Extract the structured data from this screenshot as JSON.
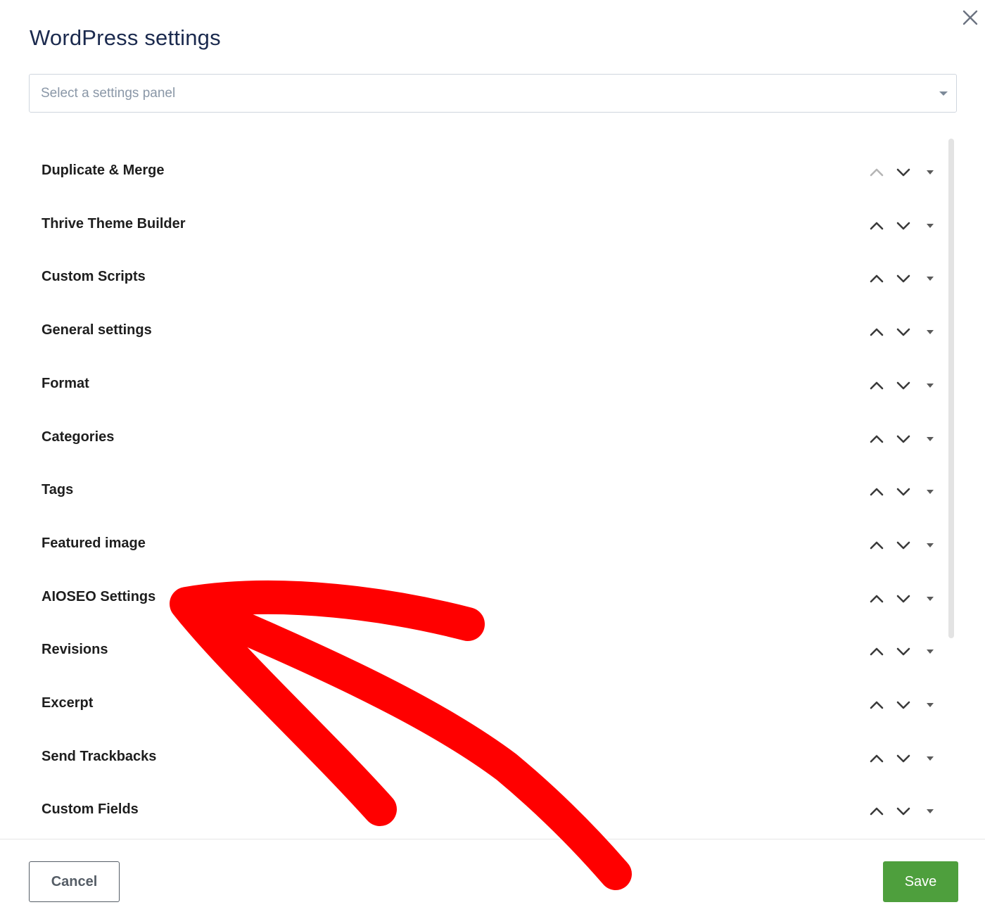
{
  "dialog": {
    "title": "WordPress settings",
    "close_icon": "close-icon"
  },
  "select": {
    "placeholder": "Select a settings panel",
    "arrow_icon": "caret-down-icon"
  },
  "panels": [
    {
      "label": "Duplicate & Merge",
      "move_up_disabled": true
    },
    {
      "label": "Thrive Theme Builder",
      "move_up_disabled": false
    },
    {
      "label": "Custom Scripts",
      "move_up_disabled": false
    },
    {
      "label": "General settings",
      "move_up_disabled": false
    },
    {
      "label": "Format",
      "move_up_disabled": false
    },
    {
      "label": "Categories",
      "move_up_disabled": false
    },
    {
      "label": "Tags",
      "move_up_disabled": false
    },
    {
      "label": "Featured image",
      "move_up_disabled": false
    },
    {
      "label": "AIOSEO Settings",
      "move_up_disabled": false
    },
    {
      "label": "Revisions",
      "move_up_disabled": false
    },
    {
      "label": "Excerpt",
      "move_up_disabled": false
    },
    {
      "label": "Send Trackbacks",
      "move_up_disabled": false
    },
    {
      "label": "Custom Fields",
      "move_up_disabled": false
    }
  ],
  "row_icons": {
    "up": "chevron-up-icon",
    "down": "chevron-down-icon",
    "toggle": "caret-down-icon"
  },
  "footer": {
    "cancel_label": "Cancel",
    "save_label": "Save"
  },
  "colors": {
    "title": "#1b2a4e",
    "save_button": "#4e9f3d",
    "annotation_arrow": "#ff0000",
    "chevron_enabled": "#3a3a3a",
    "chevron_disabled": "#b5b5b5"
  },
  "annotation": {
    "type": "red-arrow",
    "points_to": "AIOSEO Settings"
  }
}
